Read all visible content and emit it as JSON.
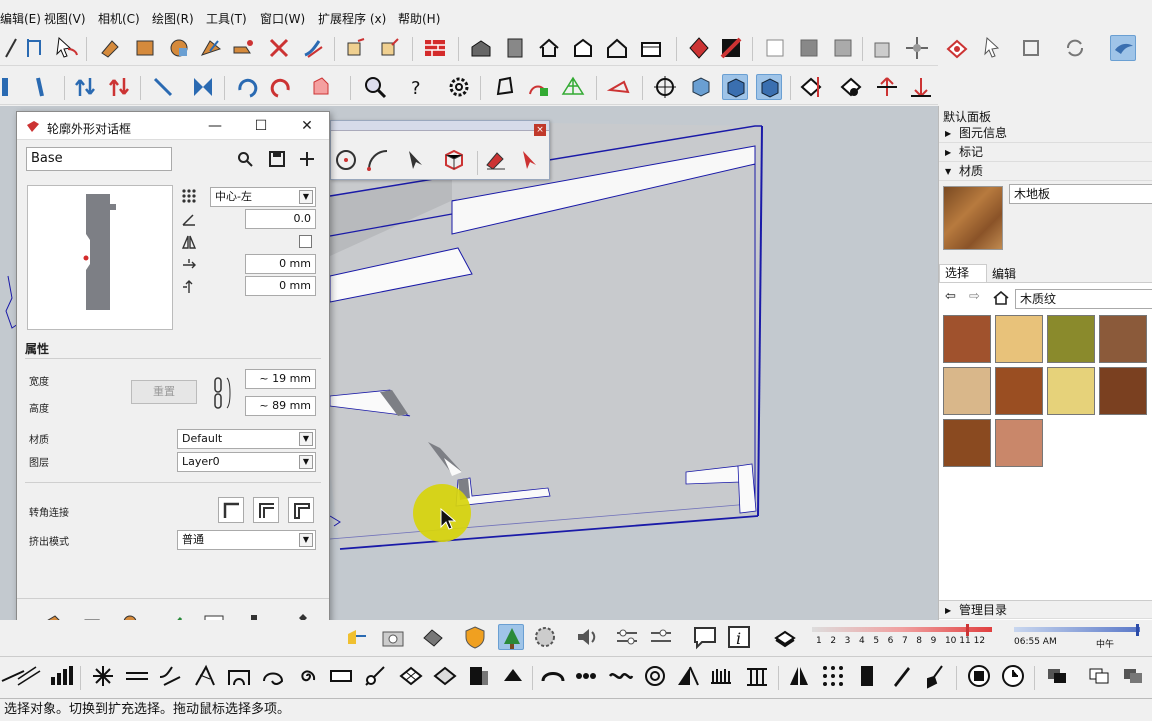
{
  "menu": [
    "编辑(E)",
    "视图(V)",
    "相机(C)",
    "绘图(R)",
    "工具(T)",
    "窗口(W)",
    "扩展程序 (x)",
    "帮助(H)"
  ],
  "dialog": {
    "title": "轮廓外形对话框",
    "search_value": "Base",
    "align_value": "中心-左",
    "angle_value": "0.0",
    "offset_x": "0 mm",
    "offset_y": "0 mm",
    "properties_title": "属性",
    "width_label": "宽度",
    "height_label": "高度",
    "reset_label": "重置",
    "width_value": "~ 19 mm",
    "height_value": "~ 89 mm",
    "material_label": "材质",
    "material_value": "Default",
    "layer_label": "图层",
    "layer_value": "Layer0",
    "corner_label": "转角连接",
    "extrude_label": "挤出模式",
    "extrude_value": "普通"
  },
  "right_panel": {
    "title": "默认面板",
    "sections": [
      "图元信息",
      "标记",
      "材质"
    ],
    "material_name": "木地板",
    "tab_select": "选择",
    "tab_edit": "编辑",
    "library": "木质纹",
    "manage_label": "管理目录",
    "swatch_colors": [
      "#a0522d",
      "#e8c27a",
      "#8a8a2c",
      "#8b5a3a",
      "#d9b78a",
      "#9a4e22",
      "#e6d27a",
      "#7a4020",
      "#8a4a20",
      "#c9876a"
    ]
  },
  "shadow": {
    "months": [
      "1",
      "2",
      "3",
      "4",
      "5",
      "6",
      "7",
      "8",
      "9",
      "10",
      "11",
      "12"
    ],
    "time": "06:55 AM",
    "noon": "中午"
  },
  "status_text": "选择对象。切换到扩充选择。拖动鼠标选择多项。",
  "colors": {
    "accent": "#1a1aa8",
    "highlight": "#d7d40b"
  }
}
